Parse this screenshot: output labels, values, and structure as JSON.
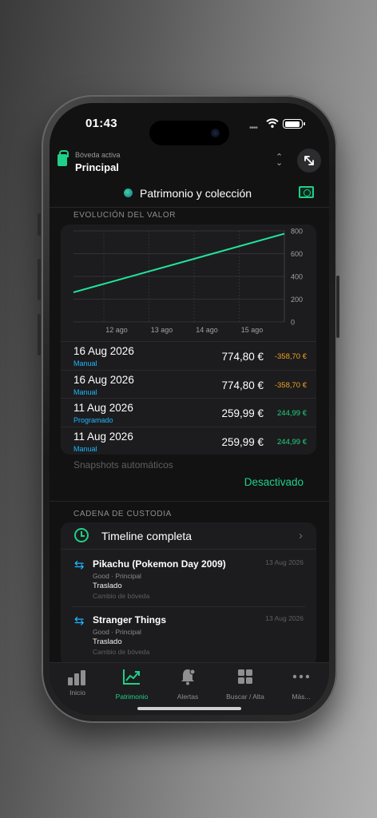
{
  "status": {
    "time": "01:43",
    "dots": "••••"
  },
  "vault": {
    "sublabel": "Bóveda activa",
    "name": "Principal"
  },
  "section": {
    "title": "Patrimonio y colección"
  },
  "value_section": {
    "heading": "EVOLUCIÓN DEL VALOR"
  },
  "chart_data": {
    "type": "line",
    "x": [
      "11 ago",
      "16 ago"
    ],
    "series": [
      {
        "values": [
          259.99,
          774.8
        ]
      }
    ],
    "x_tick_labels": [
      "12 ago",
      "13 ago",
      "14 ago",
      "15 ago"
    ],
    "y_tick_labels": [
      "800",
      "600",
      "400",
      "200",
      "0"
    ],
    "ylim": [
      0,
      800
    ],
    "grid": true,
    "line_color": "#21e69a"
  },
  "snapshots": [
    {
      "date": "16 Aug 2026",
      "source": "Manual",
      "value": "774,80 €",
      "delta": "-358,70 €",
      "trend": "neg"
    },
    {
      "date": "16 Aug 2026",
      "source": "Manual",
      "value": "774,80 €",
      "delta": "-358,70 €",
      "trend": "neg"
    },
    {
      "date": "11 Aug 2026",
      "source": "Programado",
      "value": "259,99 €",
      "delta": "244,99 €",
      "trend": "pos"
    },
    {
      "date": "11 Aug 2026",
      "source": "Manual",
      "value": "259,99 €",
      "delta": "244,99 €",
      "trend": "pos"
    }
  ],
  "auto_snapshots": {
    "label": "Snapshots automáticos",
    "value": "Desactivado"
  },
  "custody": {
    "heading": "CADENA DE CUSTODIA",
    "timeline_label": "Timeline completa",
    "events": [
      {
        "name": "Pikachu (Pokemon Day 2009)",
        "date": "13 Aug 2026",
        "meta": "Good · Principal",
        "kind": "Traslado",
        "note": "Cambio de bóveda"
      },
      {
        "name": "Stranger Things",
        "date": "13 Aug 2026",
        "meta": "Good · Principal",
        "kind": "Traslado",
        "note": "Cambio de bóveda"
      }
    ]
  },
  "tabs": [
    {
      "label": "Inicio",
      "icon": "bar-chart-icon"
    },
    {
      "label": "Patrimonio",
      "icon": "trend-chart-icon"
    },
    {
      "label": "Alertas",
      "icon": "bell-icon"
    },
    {
      "label": "Buscar / Alta",
      "icon": "grid-icon"
    },
    {
      "label": "Más...",
      "icon": "more-icon"
    }
  ],
  "colors": {
    "accent": "#1fd089",
    "blue": "#1fb6ff",
    "negative": "#f0a020",
    "positive": "#21d27f"
  }
}
